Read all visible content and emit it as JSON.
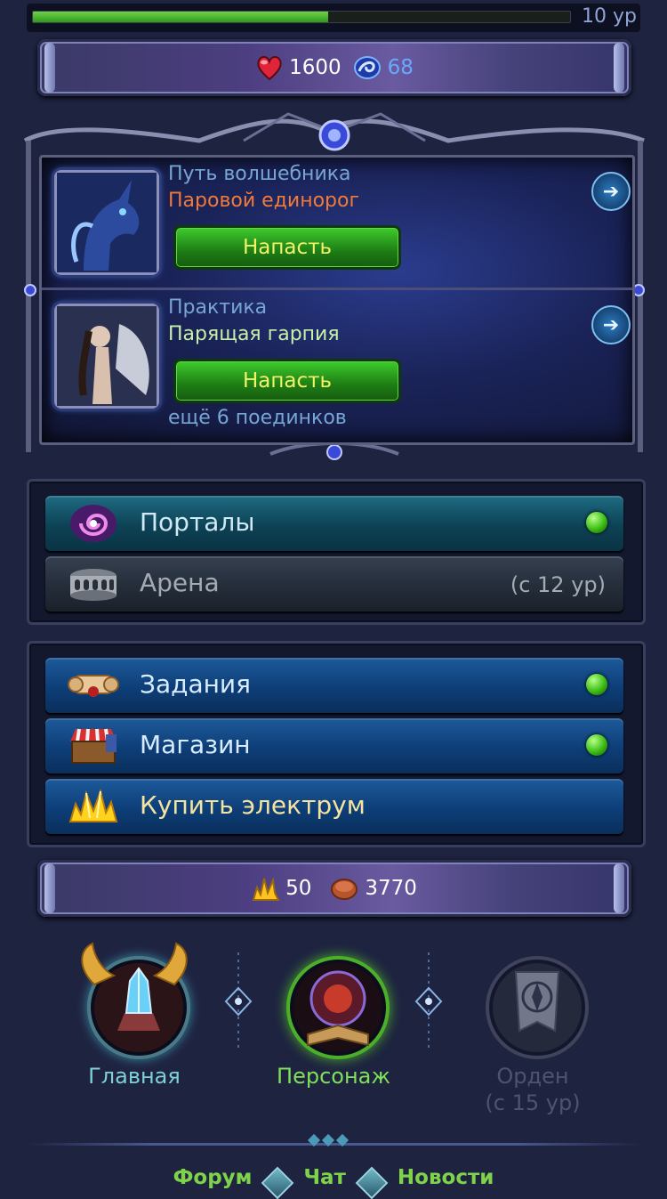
{
  "xp": {
    "level_label": "10 ур",
    "progress": 0.55
  },
  "top_stats": {
    "health": "1600",
    "mana": "68"
  },
  "duels": [
    {
      "title": "Путь волшебника",
      "opponent": "Паровой единорог",
      "attack_label": "Напасть"
    },
    {
      "title": "Практика",
      "opponent": "Парящая гарпия",
      "attack_label": "Напасть"
    }
  ],
  "duels_remaining": "ещё 6 поединков",
  "menu_primary": [
    {
      "label": "Порталы",
      "note": ""
    },
    {
      "label": "Арена",
      "note": "(с 12 ур)"
    }
  ],
  "menu_secondary": [
    {
      "label": "Задания"
    },
    {
      "label": "Магазин"
    },
    {
      "label": "Купить электрум"
    }
  ],
  "currency": {
    "electrum": "50",
    "coins": "3770"
  },
  "nav": [
    {
      "label": "Главная"
    },
    {
      "label": "Персонаж"
    },
    {
      "label": "Орден",
      "note": "(с 15 ур)"
    }
  ],
  "footer": {
    "forum": "Форум",
    "chat": "Чат",
    "news": "Новости"
  },
  "colors": {
    "opponent_1": "#f07a3a",
    "opponent_2": "#c8f0a8",
    "nav_main": "#7ed0d8",
    "nav_character": "#7fe05a",
    "nav_locked": "#747c94"
  }
}
